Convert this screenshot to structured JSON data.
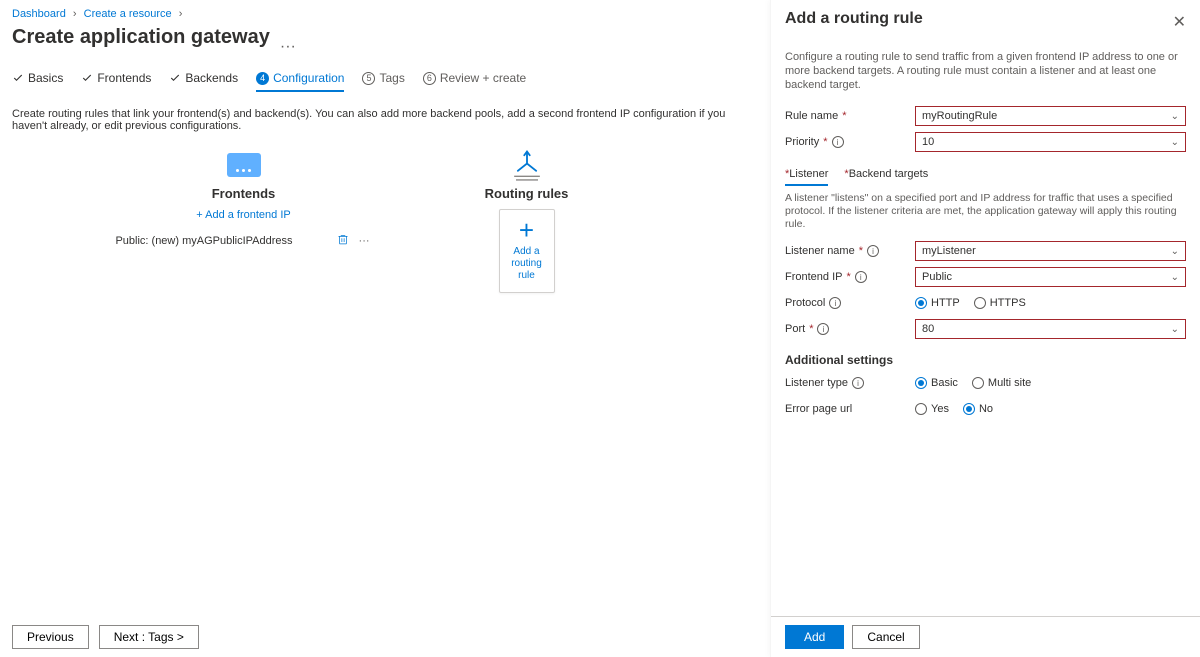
{
  "breadcrumbs": [
    {
      "label": "Dashboard"
    },
    {
      "label": "Create a resource"
    }
  ],
  "page": {
    "title": "Create application gateway",
    "subtitle_more": "···"
  },
  "tabs": [
    {
      "label": "Basics",
      "done": true
    },
    {
      "label": "Frontends",
      "done": true
    },
    {
      "label": "Backends",
      "done": true
    },
    {
      "label": "Configuration",
      "active": true,
      "num": "4"
    },
    {
      "label": "Tags",
      "num": "5",
      "muted": true
    },
    {
      "label": "Review + create",
      "num": "6",
      "muted": true
    }
  ],
  "helper_text": "Create routing rules that link your frontend(s) and backend(s). You can also add more backend pools, add a second frontend IP configuration if you haven't already, or edit previous configurations.",
  "frontends": {
    "title": "Frontends",
    "add_link": "+ Add a frontend IP",
    "rows": [
      {
        "label": "Public: (new) myAGPublicIPAddress"
      }
    ]
  },
  "rules": {
    "title": "Routing rules",
    "add_card_label": "Add a routing rule"
  },
  "footer": {
    "prev": "Previous",
    "next": "Next : Tags >"
  },
  "blade": {
    "title": "Add a routing rule",
    "desc": "Configure a routing rule to send traffic from a given frontend IP address to one or more backend targets. A routing rule must contain a listener and at least one backend target.",
    "rule_name_label": "Rule name",
    "rule_name_value": "myRoutingRule",
    "priority_label": "Priority",
    "priority_value": "10",
    "panel_tabs": {
      "listener": "Listener",
      "backend": "Backend targets"
    },
    "listener_desc": "A listener \"listens\" on a specified port and IP address for traffic that uses a specified protocol. If the listener criteria are met, the application gateway will apply this routing rule.",
    "listener_name_label": "Listener name",
    "listener_name_value": "myListener",
    "frontend_ip_label": "Frontend IP",
    "frontend_ip_value": "Public",
    "protocol_label": "Protocol",
    "protocol_options": {
      "http": "HTTP",
      "https": "HTTPS"
    },
    "protocol_selected": "HTTP",
    "port_label": "Port",
    "port_value": "80",
    "additional_head": "Additional settings",
    "listener_type_label": "Listener type",
    "listener_type_options": {
      "basic": "Basic",
      "multi": "Multi site"
    },
    "listener_type_selected": "Basic",
    "error_page_label": "Error page url",
    "error_page_options": {
      "yes": "Yes",
      "no": "No"
    },
    "error_page_selected": "No",
    "add_btn": "Add",
    "cancel_btn": "Cancel"
  }
}
